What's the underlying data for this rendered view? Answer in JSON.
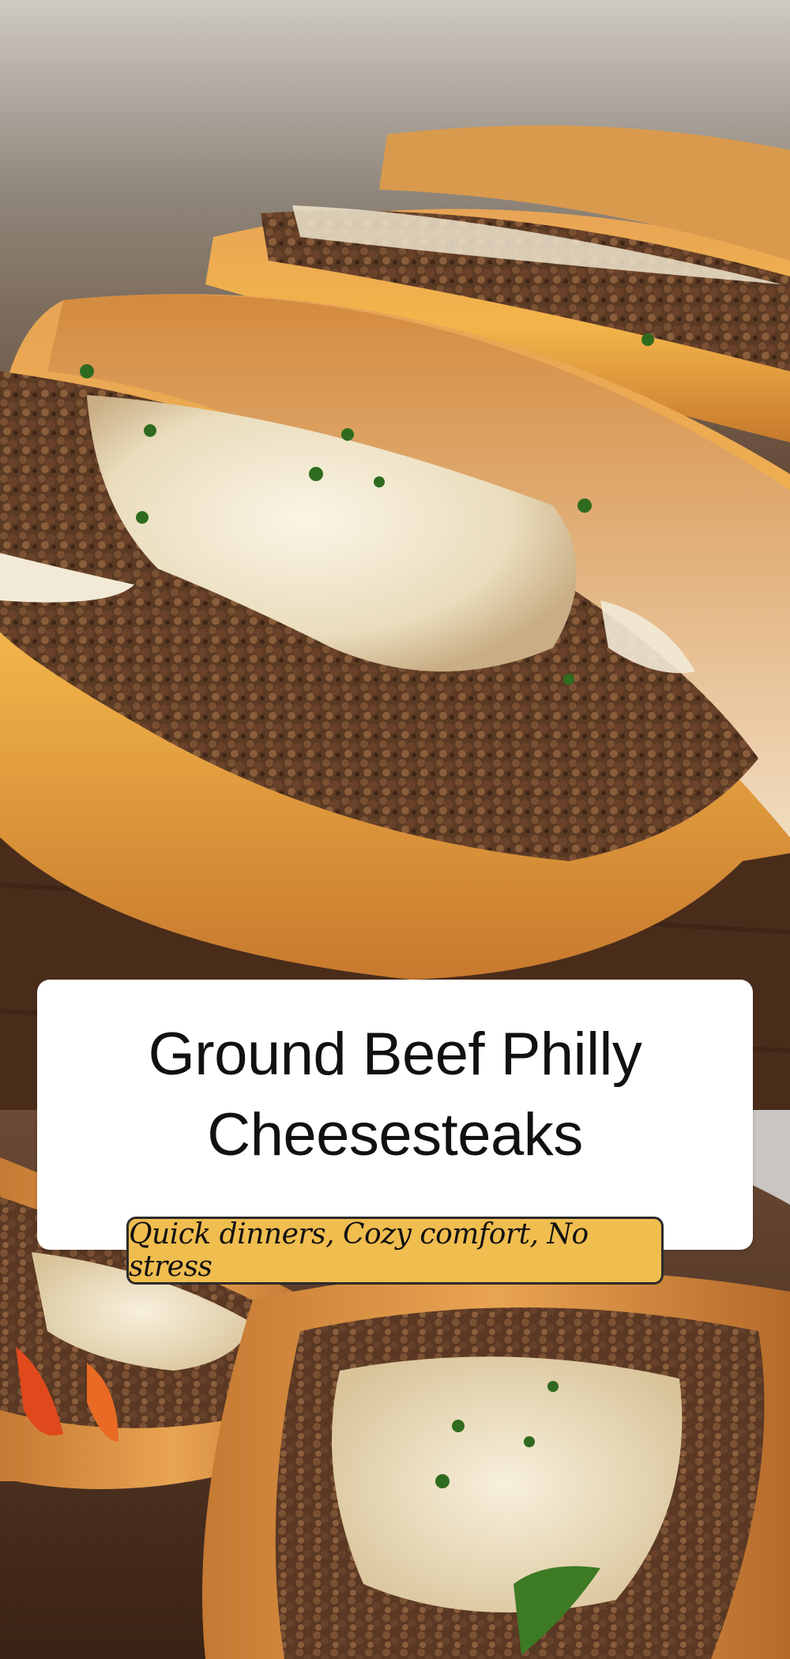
{
  "pin": {
    "title_lines": [
      "Ground Beef Philly",
      "Cheesesteaks"
    ],
    "tagline": "Quick dinners, Cozy comfort, No stress"
  },
  "images": {
    "top": "close-up-sandwich-photo",
    "bottom": "sandwiches-overhead-photo"
  },
  "colors": {
    "card_background": "#ffffff",
    "tagline_background": "#f0bd4f",
    "text": "#111111"
  }
}
